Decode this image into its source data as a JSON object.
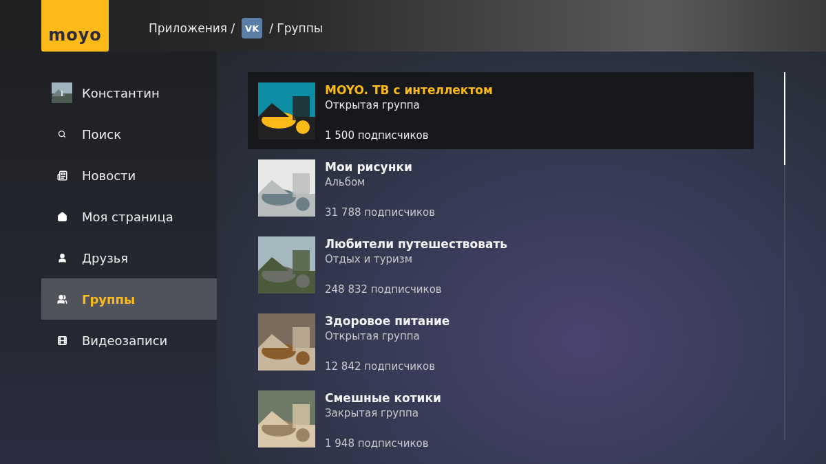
{
  "logo": "moyo",
  "breadcrumb": {
    "first": "Приложения /",
    "icon_text": "VK",
    "last": "/ Группы"
  },
  "sidebar": {
    "items": [
      {
        "kind": "profile",
        "label": "Константин",
        "selected": false
      },
      {
        "kind": "search",
        "label": "Поиск",
        "selected": false
      },
      {
        "kind": "news",
        "label": "Новости",
        "selected": false
      },
      {
        "kind": "home",
        "label": "Моя страница",
        "selected": false
      },
      {
        "kind": "friends",
        "label": "Друзья",
        "selected": false
      },
      {
        "kind": "groups",
        "label": "Группы",
        "selected": true
      },
      {
        "kind": "video",
        "label": "Видеозаписи",
        "selected": false
      }
    ]
  },
  "groups": [
    {
      "title": "MOYO. ТВ с интеллектом",
      "subtitle": "Открытая группа",
      "subscribers": "1 500 подписчиков",
      "selected": true
    },
    {
      "title": "Мои рисунки",
      "subtitle": "Альбом",
      "subscribers": "31 788 подписчиков",
      "selected": false
    },
    {
      "title": "Любители путешествовать",
      "subtitle": "Отдых и туризм",
      "subscribers": "248 832 подписчиков",
      "selected": false
    },
    {
      "title": "Здоровое питание",
      "subtitle": "Открытая группа",
      "subscribers": "12 842 подписчиков",
      "selected": false
    },
    {
      "title": "Смешные котики",
      "subtitle": "Закрытая группа",
      "subscribers": "1 948 подписчиков",
      "selected": false
    }
  ]
}
